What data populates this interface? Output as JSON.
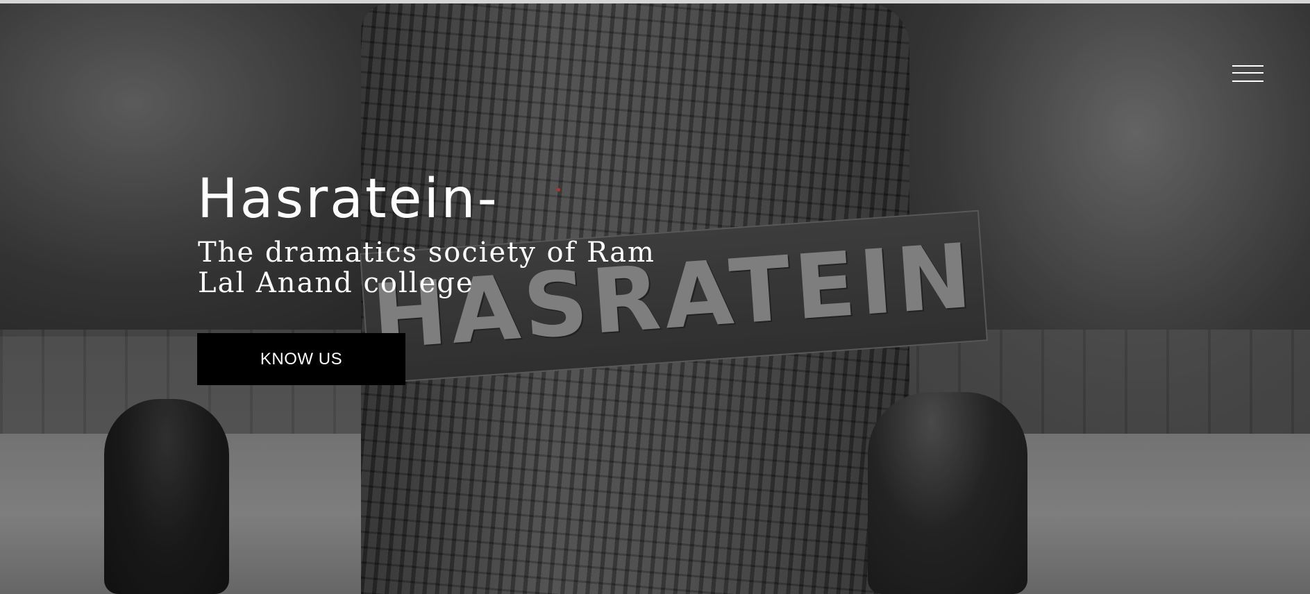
{
  "header": {
    "menu_icon": "hamburger-menu-icon"
  },
  "hero": {
    "title": "Hasratein-",
    "subtitle": "The dramatics society of Ram Lal Anand college",
    "cta_label": "KNOW US",
    "background_sign_text": "HASRATEIN",
    "button_color": "#000000",
    "text_color": "#ffffff"
  }
}
